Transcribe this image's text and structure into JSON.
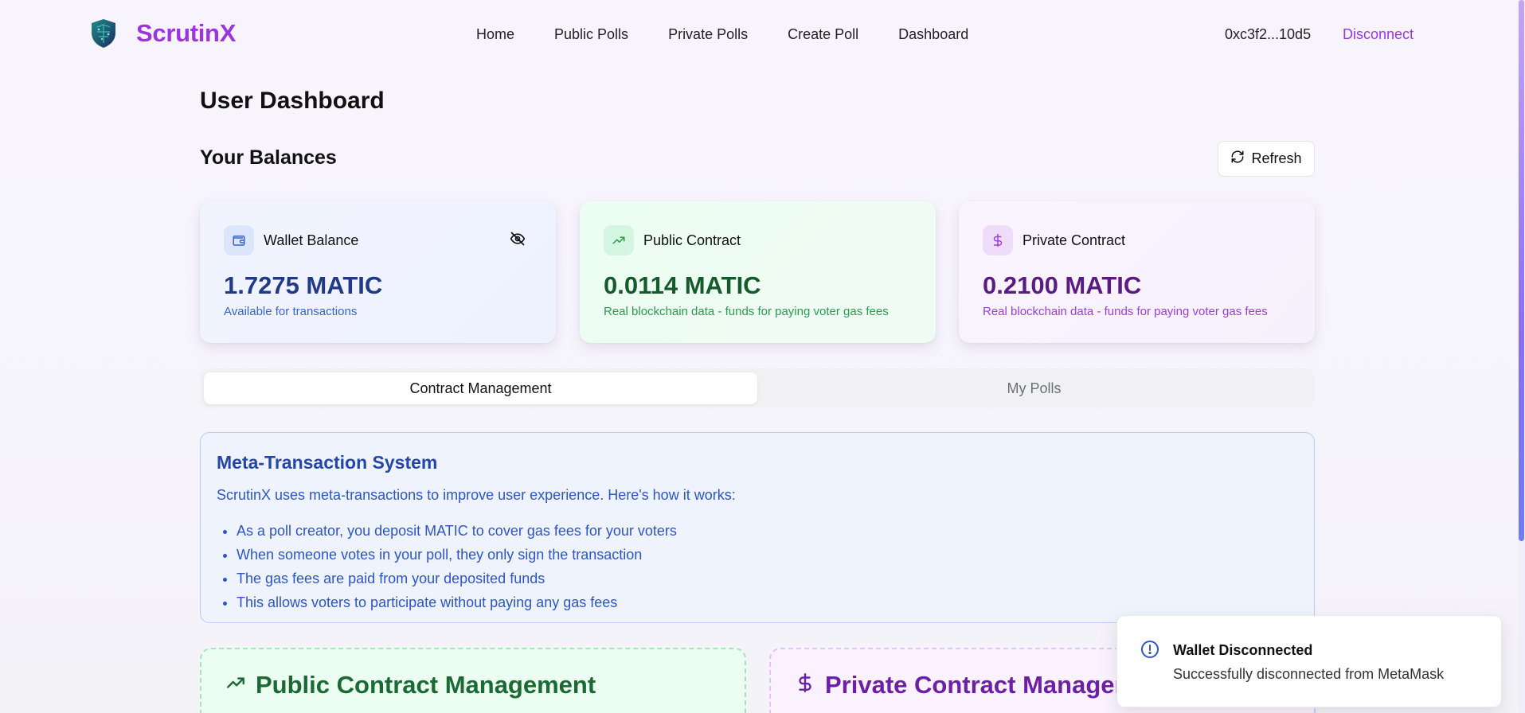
{
  "app": {
    "brand": "ScrutinX",
    "accent_color": "#9a35e0"
  },
  "nav": {
    "items": [
      {
        "label": "Home"
      },
      {
        "label": "Public Polls"
      },
      {
        "label": "Private Polls"
      },
      {
        "label": "Create Poll"
      },
      {
        "label": "Dashboard"
      }
    ],
    "wallet_address": "0xc3f2...10d5",
    "disconnect_label": "Disconnect"
  },
  "page": {
    "title": "User Dashboard",
    "balances_title": "Your Balances",
    "refresh_label": "Refresh"
  },
  "balances": [
    {
      "label": "Wallet Balance",
      "amount": "1.7275 MATIC",
      "sub": "Available for transactions",
      "icon": "wallet-icon"
    },
    {
      "label": "Public Contract",
      "amount": "0.0114 MATIC",
      "sub": "Real blockchain data - funds for paying voter gas fees",
      "icon": "trending-up-icon"
    },
    {
      "label": "Private Contract",
      "amount": "0.2100 MATIC",
      "sub": "Real blockchain data - funds for paying voter gas fees",
      "icon": "dollar-icon"
    }
  ],
  "tabs": [
    {
      "label": "Contract Management",
      "active": true
    },
    {
      "label": "My Polls",
      "active": false
    }
  ],
  "info": {
    "title": "Meta-Transaction System",
    "intro": "ScrutinX uses meta-transactions to improve user experience. Here's how it works:",
    "points": [
      "As a poll creator, you deposit MATIC to cover gas fees for your voters",
      "When someone votes in your poll, they only sign the transaction",
      "The gas fees are paid from your deposited funds",
      "This allows voters to participate without paying any gas fees"
    ]
  },
  "management": {
    "public_title": "Public Contract Management",
    "private_title": "Private Contract Managem"
  },
  "toast": {
    "title": "Wallet Disconnected",
    "description": "Successfully disconnected from MetaMask",
    "icon": "info-icon"
  }
}
